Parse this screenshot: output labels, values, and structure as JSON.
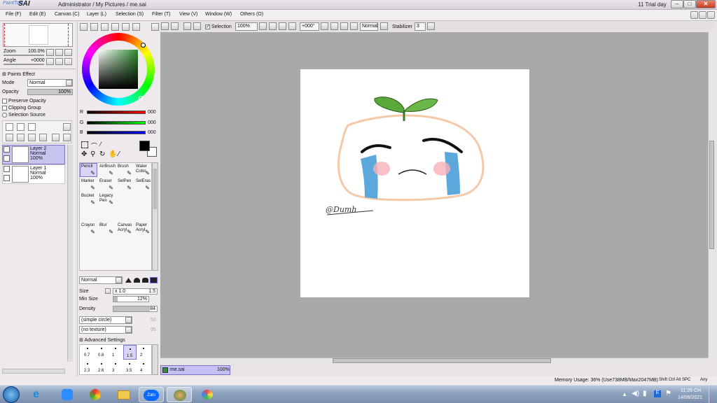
{
  "titlebar": {
    "logo_small": "PaintTool",
    "logo_big": "SAI",
    "title": "Administrator / My Pictures / me.sai",
    "trial": "11 Trial day",
    "minimize": "–",
    "maximize": "□",
    "close": "✕"
  },
  "menu": [
    "File (F)",
    "Edit (E)",
    "Canvas (C)",
    "Layer (L)",
    "Selection (S)",
    "Filter (T)",
    "View (V)",
    "Window (W)",
    "Others (O)"
  ],
  "toolbar": {
    "selection_label": "Selection",
    "zoom": "100%",
    "angle": "+000°",
    "blend": "Normal",
    "stabilizer_label": "Stabilizer",
    "stabilizer_value": "3"
  },
  "navigator": {
    "zoom_label": "Zoom",
    "zoom_value": "100.0%",
    "angle_label": "Angle",
    "angle_value": "+0000"
  },
  "layer_panel": {
    "paints_effect": "Paints Effect",
    "mode_label": "Mode",
    "mode_value": "Normal",
    "opacity_label": "Opacity",
    "opacity_value": "100%",
    "preserve_opacity": "Preserve Opacity",
    "clipping_group": "Clipping Group",
    "selection_source": "Selection Source",
    "layers": [
      {
        "name": "Layer 2",
        "mode": "Normal",
        "opacity": "100%"
      },
      {
        "name": "Layer 1",
        "mode": "Normal",
        "opacity": "100%"
      }
    ]
  },
  "color": {
    "r_label": "R",
    "g_label": "G",
    "b_label": "B",
    "r": "000",
    "g": "000",
    "b": "000",
    "current": "#000000"
  },
  "tools": [
    {
      "label1": "Pencil",
      "label2": ""
    },
    {
      "label1": "AirBrush",
      "label2": ""
    },
    {
      "label1": "Brush",
      "label2": ""
    },
    {
      "label1": "Water",
      "label2": "Color"
    },
    {
      "label1": "Marker",
      "label2": ""
    },
    {
      "label1": "Eraser",
      "label2": ""
    },
    {
      "label1": "SelPen",
      "label2": ""
    },
    {
      "label1": "SelEras",
      "label2": ""
    },
    {
      "label1": "Bucket",
      "label2": ""
    },
    {
      "label1": "Legacy",
      "label2": "Pen"
    },
    {
      "label1": "Canvas",
      "label2": "Acryl"
    },
    {
      "label1": "Paper",
      "label2": "Acryl"
    },
    {
      "label1": "Crayon",
      "label2": ""
    },
    {
      "label1": "Blur",
      "label2": ""
    }
  ],
  "brush": {
    "blend": "Normal",
    "size_label": "Size",
    "size_mult": "x 1.0",
    "size_value": "1.5",
    "min_size_label": "Min Size",
    "min_size_value": "12%",
    "density_label": "Density",
    "density_value": "84",
    "shape": "(simple circle)",
    "shape_value": "50",
    "texture": "(no texture)",
    "texture_value": "95",
    "advanced": "Advanced Settings",
    "sizes_row1": [
      "0.7",
      "0.8",
      "1",
      "1.5",
      "2"
    ],
    "sizes_row2": [
      "2.3",
      "2.6",
      "3",
      "3.5",
      "4"
    ]
  },
  "doc_tab": {
    "name": "me.sai",
    "zoom": "100%"
  },
  "drawing": {
    "signature": "@Dumh"
  },
  "status": {
    "memory": "Memory Usage: 36% (Use738MB/Max2047MB)",
    "keys": "Shift Ctrl Alt SPC",
    "any": "Any"
  },
  "taskbar": {
    "time": "11:26 CH",
    "date": "14/06/2021",
    "zalo": "Zalo"
  }
}
